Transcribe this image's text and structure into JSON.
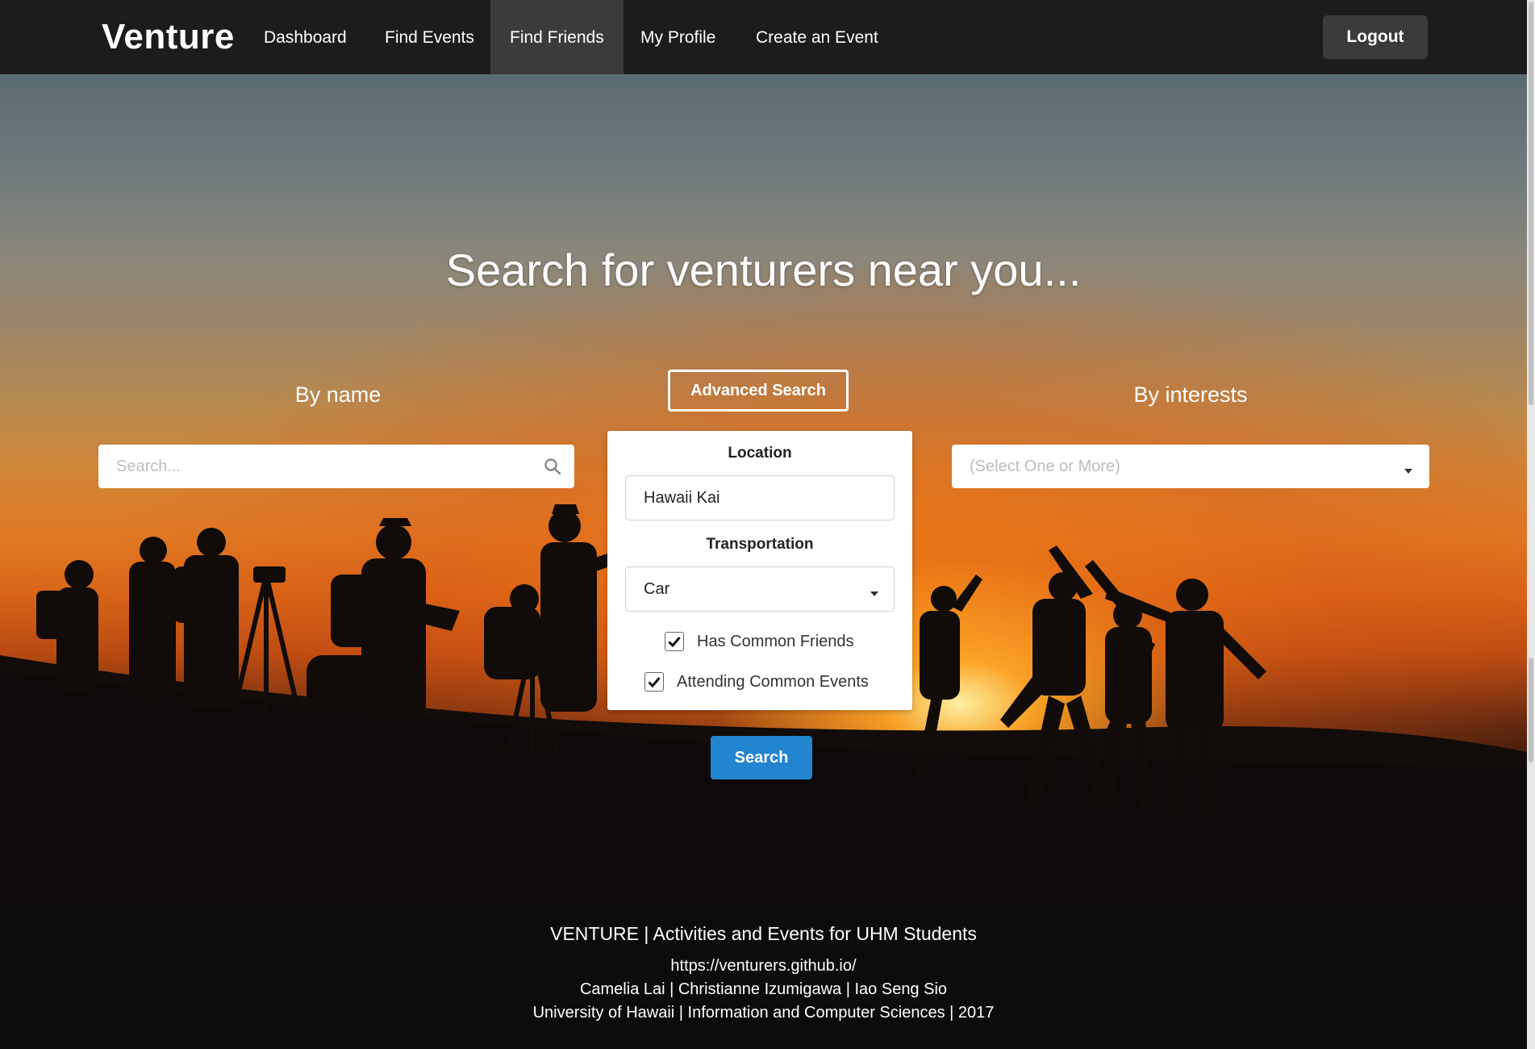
{
  "navbar": {
    "brand": "Venture",
    "items": [
      {
        "label": "Dashboard"
      },
      {
        "label": "Find Events"
      },
      {
        "label": "Find Friends"
      },
      {
        "label": "My Profile"
      },
      {
        "label": "Create an Event"
      }
    ],
    "active_item": "Find Friends",
    "logout_label": "Logout"
  },
  "hero": {
    "title": "Search for venturers near you...",
    "by_name": {
      "label": "By name",
      "placeholder": "Search...",
      "icon": "search-icon"
    },
    "advanced": {
      "button_label": "Advanced Search",
      "location_label": "Location",
      "location_value": "Hawaii Kai",
      "transportation_label": "Transportation",
      "transportation_value": "Car",
      "checkboxes": [
        {
          "label": "Has Common Friends",
          "checked": true
        },
        {
          "label": "Attending Common Events",
          "checked": true
        }
      ]
    },
    "by_interests": {
      "label": "By interests",
      "placeholder": "(Select One or More)"
    },
    "search_button": "Search"
  },
  "footer": {
    "line1": "VENTURE | Activities and Events for UHM Students",
    "url": "https://venturers.github.io/",
    "authors": "Camelia Lai | Christianne Izumigawa | Iao Seng Sio",
    "org": "University of Hawaii | Information and Computer Sciences | 2017"
  },
  "colors": {
    "navbar_bg": "#1b1c1d",
    "active_nav_bg": "#3a3b3c",
    "primary_button": "#2185d0",
    "footer_bg": "#0c0c0c"
  }
}
